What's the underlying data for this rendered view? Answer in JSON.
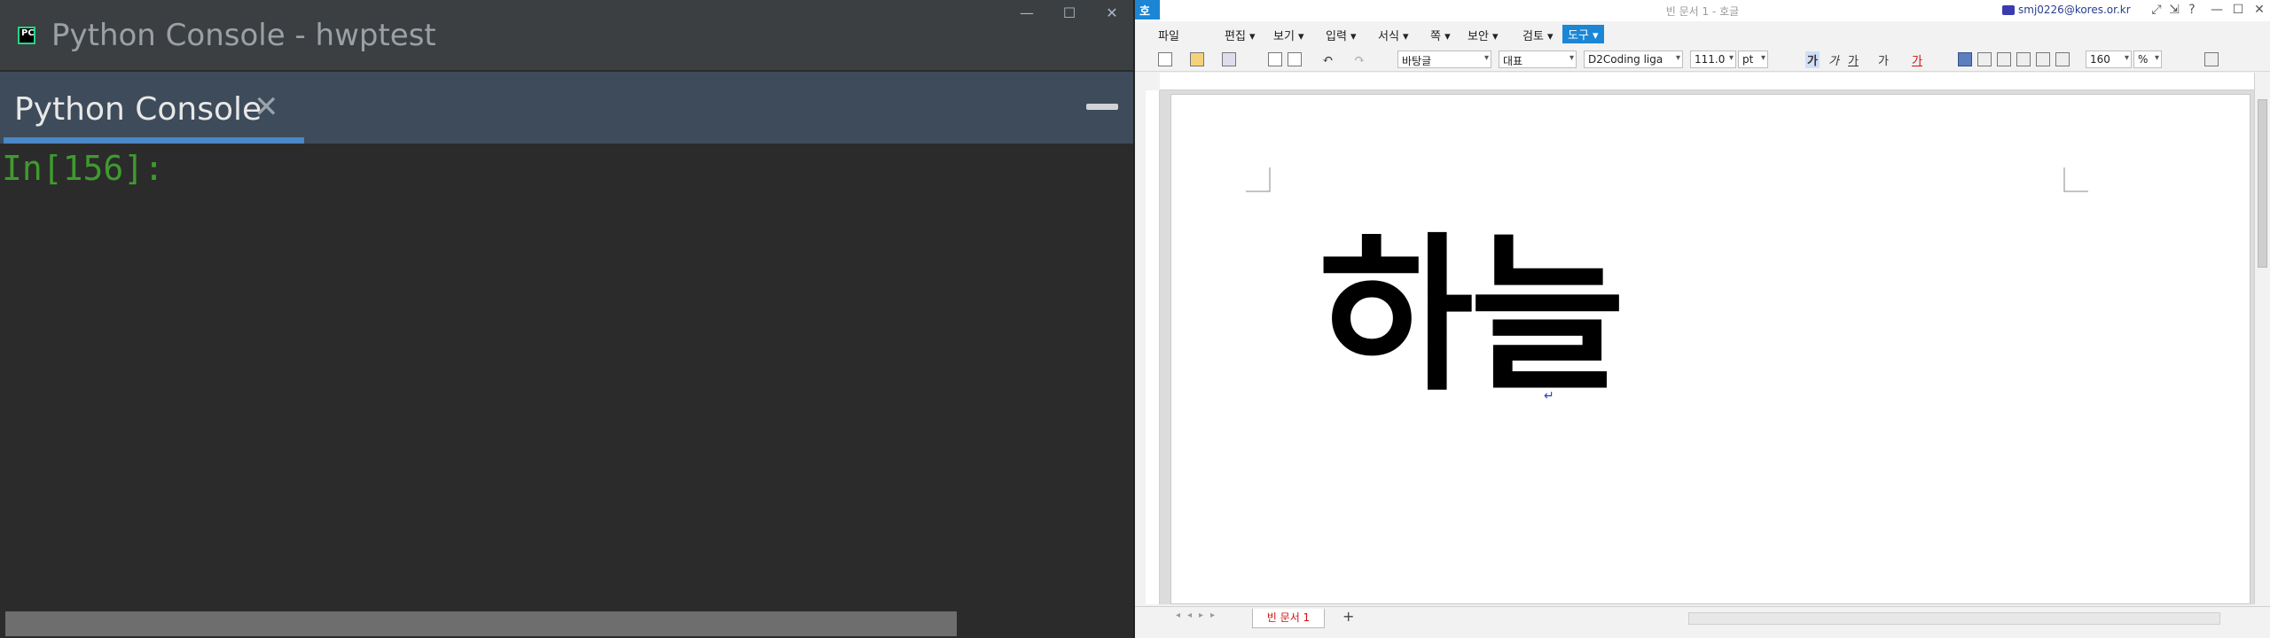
{
  "pycharm": {
    "window_title": "Python Console - hwptest",
    "app_icon_text": "PC",
    "controls": {
      "minimize": "—",
      "maximize": "☐",
      "close": "✕"
    },
    "tab_label": "Python Console",
    "tab_close": "✕",
    "prompt": "In[156]:",
    "colors": {
      "accent": "#4a88c7",
      "prompt": "#3f9a2f",
      "background": "#2b2b2b",
      "tabbar": "#3e4b5a"
    }
  },
  "hwp": {
    "app_logo": "호",
    "doc_title": "빈 문서 1 - 호글",
    "user": "smj0226@kores.or.kr",
    "title_controls": [
      "⤢",
      "⇲",
      "?",
      "—",
      "☐",
      "✕"
    ],
    "menus": [
      {
        "label": "파일"
      },
      {
        "label": "편집 ▾"
      },
      {
        "label": "보기 ▾"
      },
      {
        "label": "입력 ▾"
      },
      {
        "label": "서식 ▾"
      },
      {
        "label": "쪽 ▾"
      },
      {
        "label": "보안 ▾"
      },
      {
        "label": "검토 ▾"
      },
      {
        "label": "도구 ▾"
      }
    ],
    "style_combo": "바탕글",
    "lang_combo": "대표",
    "font_combo": "D2Coding liga",
    "size_combo": "111.0",
    "size_unit": "pt",
    "zoom_combo": "160",
    "zoom_unit": "%",
    "format_bold": "가",
    "format_italic": "가",
    "format_underline": "가",
    "format_strike": "가",
    "format_color": "가",
    "document_text": "하늘",
    "paragraph_mark": "↵",
    "sheet_tab": "빈 문서 1",
    "add_sheet": "+",
    "sheet_nav": "◂◂▸▸",
    "colors": {
      "accent": "#1b86d6",
      "sheet_tab_text": "#d01010"
    }
  }
}
